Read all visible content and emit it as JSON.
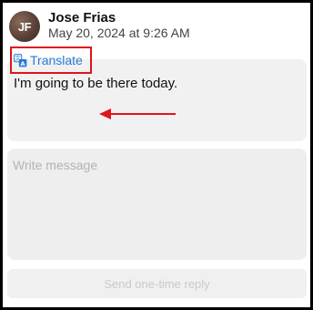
{
  "sender": {
    "initials": "JF",
    "name": "Jose Frias",
    "timestamp": "May 20, 2024 at 9:26 AM"
  },
  "message": {
    "text": "I'm going to be there today.",
    "translate_label": "Translate",
    "translate_icon": "translate-icon"
  },
  "compose": {
    "placeholder": "Write message",
    "value": ""
  },
  "send_button": {
    "label": "Send one-time reply",
    "enabled": false
  },
  "colors": {
    "link": "#2a7ad6",
    "highlight": "#e0141e",
    "card_background": "#f1f1f1"
  }
}
